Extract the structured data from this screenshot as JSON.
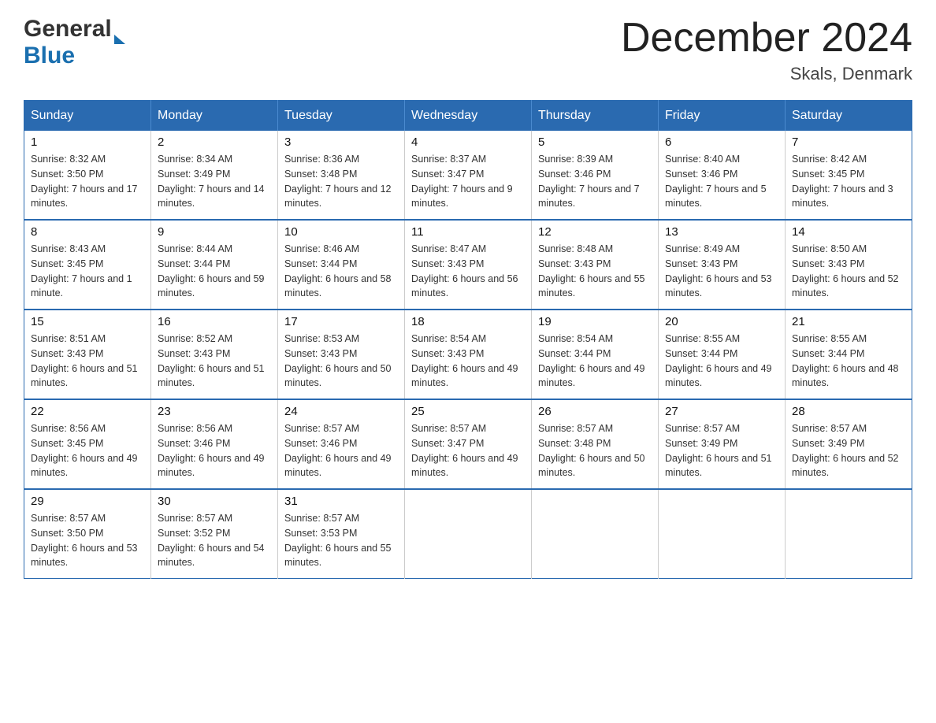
{
  "header": {
    "logo": {
      "general": "General",
      "blue": "Blue"
    },
    "title": "December 2024",
    "location": "Skals, Denmark"
  },
  "calendar": {
    "days_of_week": [
      "Sunday",
      "Monday",
      "Tuesday",
      "Wednesday",
      "Thursday",
      "Friday",
      "Saturday"
    ],
    "weeks": [
      [
        {
          "day": "1",
          "sunrise": "Sunrise: 8:32 AM",
          "sunset": "Sunset: 3:50 PM",
          "daylight": "Daylight: 7 hours and 17 minutes."
        },
        {
          "day": "2",
          "sunrise": "Sunrise: 8:34 AM",
          "sunset": "Sunset: 3:49 PM",
          "daylight": "Daylight: 7 hours and 14 minutes."
        },
        {
          "day": "3",
          "sunrise": "Sunrise: 8:36 AM",
          "sunset": "Sunset: 3:48 PM",
          "daylight": "Daylight: 7 hours and 12 minutes."
        },
        {
          "day": "4",
          "sunrise": "Sunrise: 8:37 AM",
          "sunset": "Sunset: 3:47 PM",
          "daylight": "Daylight: 7 hours and 9 minutes."
        },
        {
          "day": "5",
          "sunrise": "Sunrise: 8:39 AM",
          "sunset": "Sunset: 3:46 PM",
          "daylight": "Daylight: 7 hours and 7 minutes."
        },
        {
          "day": "6",
          "sunrise": "Sunrise: 8:40 AM",
          "sunset": "Sunset: 3:46 PM",
          "daylight": "Daylight: 7 hours and 5 minutes."
        },
        {
          "day": "7",
          "sunrise": "Sunrise: 8:42 AM",
          "sunset": "Sunset: 3:45 PM",
          "daylight": "Daylight: 7 hours and 3 minutes."
        }
      ],
      [
        {
          "day": "8",
          "sunrise": "Sunrise: 8:43 AM",
          "sunset": "Sunset: 3:45 PM",
          "daylight": "Daylight: 7 hours and 1 minute."
        },
        {
          "day": "9",
          "sunrise": "Sunrise: 8:44 AM",
          "sunset": "Sunset: 3:44 PM",
          "daylight": "Daylight: 6 hours and 59 minutes."
        },
        {
          "day": "10",
          "sunrise": "Sunrise: 8:46 AM",
          "sunset": "Sunset: 3:44 PM",
          "daylight": "Daylight: 6 hours and 58 minutes."
        },
        {
          "day": "11",
          "sunrise": "Sunrise: 8:47 AM",
          "sunset": "Sunset: 3:43 PM",
          "daylight": "Daylight: 6 hours and 56 minutes."
        },
        {
          "day": "12",
          "sunrise": "Sunrise: 8:48 AM",
          "sunset": "Sunset: 3:43 PM",
          "daylight": "Daylight: 6 hours and 55 minutes."
        },
        {
          "day": "13",
          "sunrise": "Sunrise: 8:49 AM",
          "sunset": "Sunset: 3:43 PM",
          "daylight": "Daylight: 6 hours and 53 minutes."
        },
        {
          "day": "14",
          "sunrise": "Sunrise: 8:50 AM",
          "sunset": "Sunset: 3:43 PM",
          "daylight": "Daylight: 6 hours and 52 minutes."
        }
      ],
      [
        {
          "day": "15",
          "sunrise": "Sunrise: 8:51 AM",
          "sunset": "Sunset: 3:43 PM",
          "daylight": "Daylight: 6 hours and 51 minutes."
        },
        {
          "day": "16",
          "sunrise": "Sunrise: 8:52 AM",
          "sunset": "Sunset: 3:43 PM",
          "daylight": "Daylight: 6 hours and 51 minutes."
        },
        {
          "day": "17",
          "sunrise": "Sunrise: 8:53 AM",
          "sunset": "Sunset: 3:43 PM",
          "daylight": "Daylight: 6 hours and 50 minutes."
        },
        {
          "day": "18",
          "sunrise": "Sunrise: 8:54 AM",
          "sunset": "Sunset: 3:43 PM",
          "daylight": "Daylight: 6 hours and 49 minutes."
        },
        {
          "day": "19",
          "sunrise": "Sunrise: 8:54 AM",
          "sunset": "Sunset: 3:44 PM",
          "daylight": "Daylight: 6 hours and 49 minutes."
        },
        {
          "day": "20",
          "sunrise": "Sunrise: 8:55 AM",
          "sunset": "Sunset: 3:44 PM",
          "daylight": "Daylight: 6 hours and 49 minutes."
        },
        {
          "day": "21",
          "sunrise": "Sunrise: 8:55 AM",
          "sunset": "Sunset: 3:44 PM",
          "daylight": "Daylight: 6 hours and 48 minutes."
        }
      ],
      [
        {
          "day": "22",
          "sunrise": "Sunrise: 8:56 AM",
          "sunset": "Sunset: 3:45 PM",
          "daylight": "Daylight: 6 hours and 49 minutes."
        },
        {
          "day": "23",
          "sunrise": "Sunrise: 8:56 AM",
          "sunset": "Sunset: 3:46 PM",
          "daylight": "Daylight: 6 hours and 49 minutes."
        },
        {
          "day": "24",
          "sunrise": "Sunrise: 8:57 AM",
          "sunset": "Sunset: 3:46 PM",
          "daylight": "Daylight: 6 hours and 49 minutes."
        },
        {
          "day": "25",
          "sunrise": "Sunrise: 8:57 AM",
          "sunset": "Sunset: 3:47 PM",
          "daylight": "Daylight: 6 hours and 49 minutes."
        },
        {
          "day": "26",
          "sunrise": "Sunrise: 8:57 AM",
          "sunset": "Sunset: 3:48 PM",
          "daylight": "Daylight: 6 hours and 50 minutes."
        },
        {
          "day": "27",
          "sunrise": "Sunrise: 8:57 AM",
          "sunset": "Sunset: 3:49 PM",
          "daylight": "Daylight: 6 hours and 51 minutes."
        },
        {
          "day": "28",
          "sunrise": "Sunrise: 8:57 AM",
          "sunset": "Sunset: 3:49 PM",
          "daylight": "Daylight: 6 hours and 52 minutes."
        }
      ],
      [
        {
          "day": "29",
          "sunrise": "Sunrise: 8:57 AM",
          "sunset": "Sunset: 3:50 PM",
          "daylight": "Daylight: 6 hours and 53 minutes."
        },
        {
          "day": "30",
          "sunrise": "Sunrise: 8:57 AM",
          "sunset": "Sunset: 3:52 PM",
          "daylight": "Daylight: 6 hours and 54 minutes."
        },
        {
          "day": "31",
          "sunrise": "Sunrise: 8:57 AM",
          "sunset": "Sunset: 3:53 PM",
          "daylight": "Daylight: 6 hours and 55 minutes."
        },
        null,
        null,
        null,
        null
      ]
    ]
  }
}
